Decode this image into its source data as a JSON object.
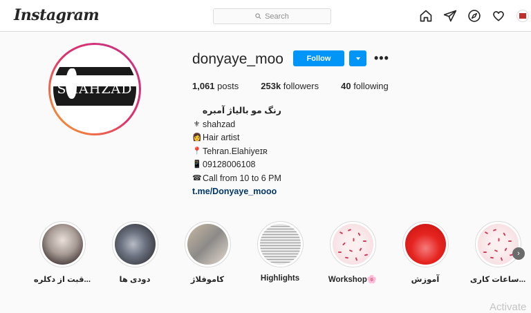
{
  "header": {
    "logo": "Instagram",
    "search_placeholder": "Search",
    "icons": [
      "home-icon",
      "direct-icon",
      "explore-icon",
      "activity-heart-icon",
      "profile-avatar-icon"
    ]
  },
  "profile": {
    "username": "donyaye_moo",
    "follow_label": "Follow",
    "more_label": "•••",
    "stats": {
      "posts_count": "1,061",
      "posts_label": "posts",
      "followers_count": "253k",
      "followers_label": "followers",
      "following_count": "40",
      "following_label": "following"
    },
    "bio": {
      "title": "رنگ مو بالیاژ آمبره",
      "lines": [
        {
          "emoji": "⚜",
          "text": "shahzad"
        },
        {
          "emoji": "👩",
          "text": "Hair artist"
        },
        {
          "emoji": "📍",
          "text": "Tehran.Elahiyeɪʀ"
        },
        {
          "emoji": "📱",
          "text": " 09128006108"
        },
        {
          "emoji": "☎",
          "text": "Call from 10 to 6 PM"
        }
      ],
      "link": "t.me/Donyaye_mooo"
    },
    "avatar_text": "SHAHZAD"
  },
  "highlights": [
    {
      "label": "قبت از دکلره..."
    },
    {
      "label": "دودی ها"
    },
    {
      "label": "کاموفلاژ"
    },
    {
      "label": "Highlights"
    },
    {
      "label": "Workshop🌸"
    },
    {
      "label": "آموزش"
    },
    {
      "label": "ساعات کاری..."
    }
  ],
  "watermark": "Activate",
  "colors": {
    "accent": "#0095f6",
    "link": "#00376b",
    "border": "#dbdbdb",
    "background": "#fafafa"
  }
}
